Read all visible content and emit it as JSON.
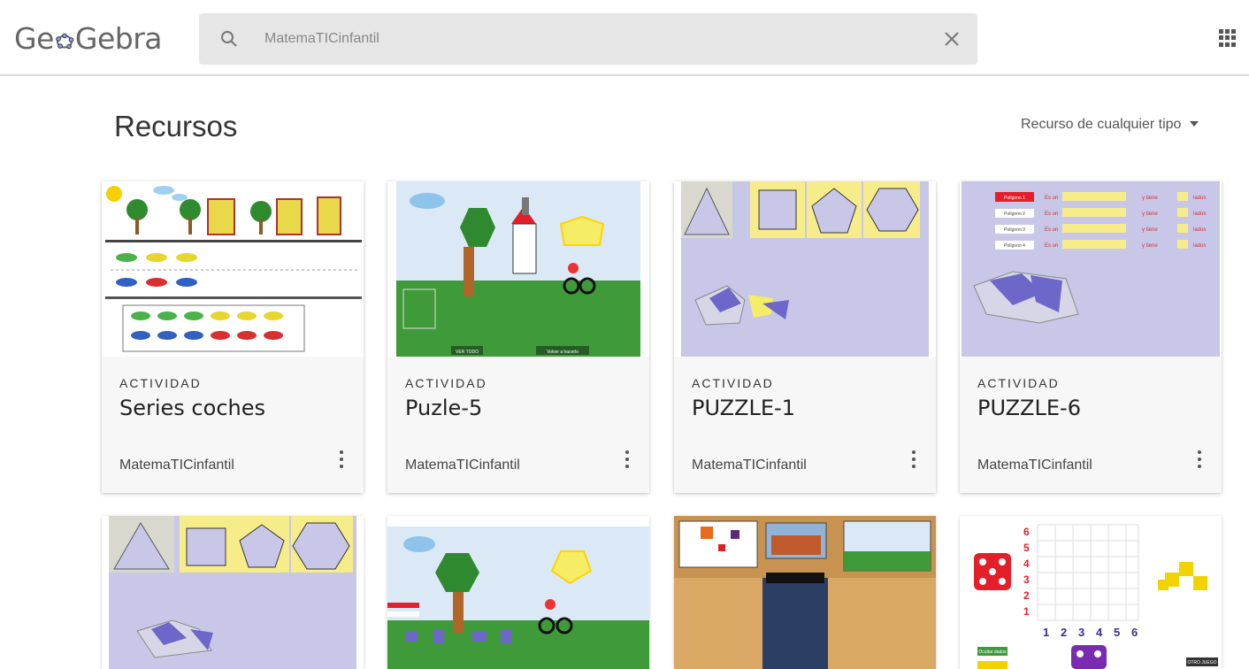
{
  "header": {
    "logo_text_a": "Ge",
    "logo_text_b": "Gebra",
    "search_value": "MatemaTICinfantil"
  },
  "page": {
    "title": "Recursos",
    "filter_label": "Recurso de cualquier tipo"
  },
  "cards": [
    {
      "type": "ACTIVIDAD",
      "title": "Series coches",
      "author": "MatemaTICinfantil"
    },
    {
      "type": "ACTIVIDAD",
      "title": "Puzle-5",
      "author": "MatemaTICinfantil",
      "thumb_buttons": [
        "VER TODO",
        "Volver a hacerlo"
      ]
    },
    {
      "type": "ACTIVIDAD",
      "title": "PUZZLE-1",
      "author": "MatemaTICinfantil"
    },
    {
      "type": "ACTIVIDAD",
      "title": "PUZZLE-6",
      "author": "MatemaTICinfantil",
      "thumb_rows": [
        {
          "button": "Polígono 1",
          "is": "Es un",
          "has": "y tiene",
          "sides": "lados"
        },
        {
          "button": "Polígono 2",
          "is": "Es un",
          "has": "y tiene",
          "sides": "lados"
        },
        {
          "button": "Polígono 3",
          "is": "Es un",
          "has": "y tiene",
          "sides": "lados"
        },
        {
          "button": "Polígono 4",
          "is": "Es un",
          "has": "y tiene",
          "sides": "lados"
        }
      ]
    },
    {},
    {},
    {},
    {
      "thumb_axis_y": [
        "6",
        "5",
        "4",
        "3",
        "2",
        "1"
      ],
      "thumb_axis_x": [
        "1",
        "2",
        "3",
        "4",
        "5",
        "6"
      ],
      "thumb_button_1": "Ocultar dados",
      "thumb_button_2": "OTRO JUEGO"
    }
  ],
  "colors": {
    "accent_lilac": "#c9c7e8",
    "sky": "#dbe9f7",
    "grass": "#3f9a3a",
    "sun": "#f6ed8a"
  }
}
